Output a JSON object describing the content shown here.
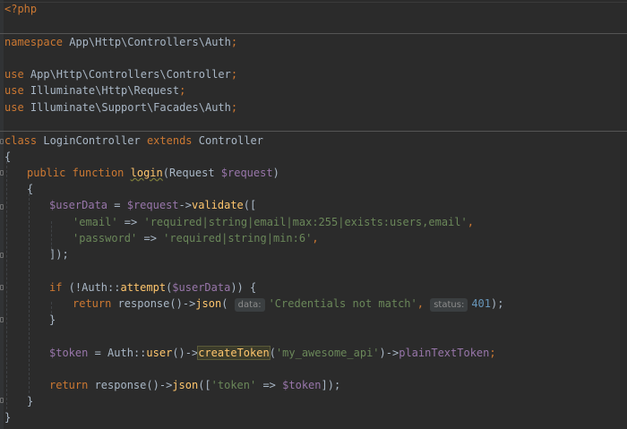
{
  "editor": {
    "language": "php",
    "colors": {
      "background": "#2b2b2b",
      "keyword": "#cc7832",
      "function": "#ffc66d",
      "variable": "#9876aa",
      "string": "#6a8759",
      "number": "#6897bb",
      "default": "#a9b7c6"
    }
  },
  "code": {
    "open_tag": "<?php",
    "kw_namespace": "namespace",
    "namespace_path": " App\\Http\\Controllers\\Auth",
    "semi": ";",
    "kw_use": "use",
    "use1_path": " App\\Http\\Controllers\\Controller",
    "use2_path": " Illuminate\\Http\\Request",
    "use3_path": " Illuminate\\Support\\Facades\\Auth",
    "kw_class": "class",
    "class_name": " LoginController ",
    "kw_extends": "extends",
    "parent_class": " Controller",
    "brace_open": "{",
    "brace_close": "}",
    "kw_public": "public",
    "kw_function": "function",
    "fn_login": "login",
    "paren_open": "(",
    "param_type": "Request ",
    "var_request": "$request",
    "paren_close": ")",
    "var_userData": "$userData",
    "assign": " = ",
    "arrow": "->",
    "fn_validate": "validate",
    "open_bracket": "([",
    "str_email_key": "'email'",
    "str_email_rule": "'required|string|email|max:255|exists:users,email'",
    "fat_arrow": " => ",
    "comma": ",",
    "str_password_key": "'password'",
    "str_password_rule": "'required|string|min:6'",
    "close_bracket": "]);",
    "kw_if": "if",
    "if_cond_open": " (!Auth",
    "double_colon": "::",
    "fn_attempt": "attempt",
    "if_cond_close": ")) {",
    "kw_return": "return",
    "fn_response": " response",
    "call_open": "()",
    "fn_json": "json",
    "hint_data": "data:",
    "str_credentials": "'Credentials not match'",
    "hint_status": "status:",
    "num_401": "401",
    "call_end": ");",
    "var_token": "$token",
    "auth_class": "Auth",
    "fn_user": "user",
    "fn_createToken": "createToken",
    "str_api": "'my_awesome_api'",
    "fn_plainTextToken": "plainTextToken",
    "str_token_key": "'token'",
    "json_open": "([",
    "json_close": "]);"
  }
}
